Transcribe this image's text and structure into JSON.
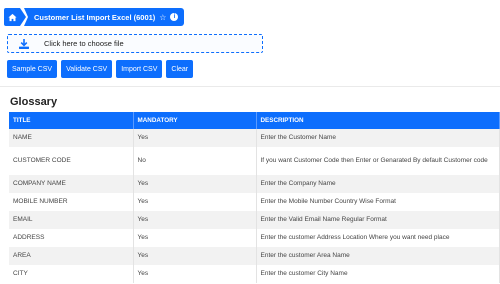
{
  "breadcrumb": {
    "home_icon": "home-icon",
    "title": "Customer List Import Excel (6001)",
    "star_glyph": "☆",
    "info_glyph": "i"
  },
  "upload": {
    "icon": "download-icon",
    "label": "Click here to choose file"
  },
  "actions": {
    "sample_csv": "Sample CSV",
    "validate_csv": "Validate CSV",
    "import_csv": "Import CSV",
    "clear": "Clear"
  },
  "glossary": {
    "heading": "Glossary",
    "columns": [
      "TITLE",
      "MANDATORY",
      "DESCRIPTION"
    ],
    "rows": [
      {
        "title": "NAME",
        "mandatory": "Yes",
        "description": "Enter the Customer Name"
      },
      {
        "title": "CUSTOMER CODE",
        "mandatory": "No",
        "description": "If you want Customer Code then Enter or Genarated By default Customer code"
      },
      {
        "title": "COMPANY NAME",
        "mandatory": "Yes",
        "description": "Enter the Company Name"
      },
      {
        "title": "MOBILE NUMBER",
        "mandatory": "Yes",
        "description": "Enter the Mobile Number Country Wise Format"
      },
      {
        "title": "EMAIL",
        "mandatory": "Yes",
        "description": "Enter the Valid Email Name Regular Format"
      },
      {
        "title": "ADDRESS",
        "mandatory": "Yes",
        "description": "Enter the customer Address Location Where you want need place"
      },
      {
        "title": "AREA",
        "mandatory": "Yes",
        "description": "Enter the customer Area Name"
      },
      {
        "title": "CITY",
        "mandatory": "Yes",
        "description": "Enter the customer City Name"
      }
    ]
  },
  "colors": {
    "accent": "#0d6efd",
    "row_stripe": "#f2f2f2"
  }
}
